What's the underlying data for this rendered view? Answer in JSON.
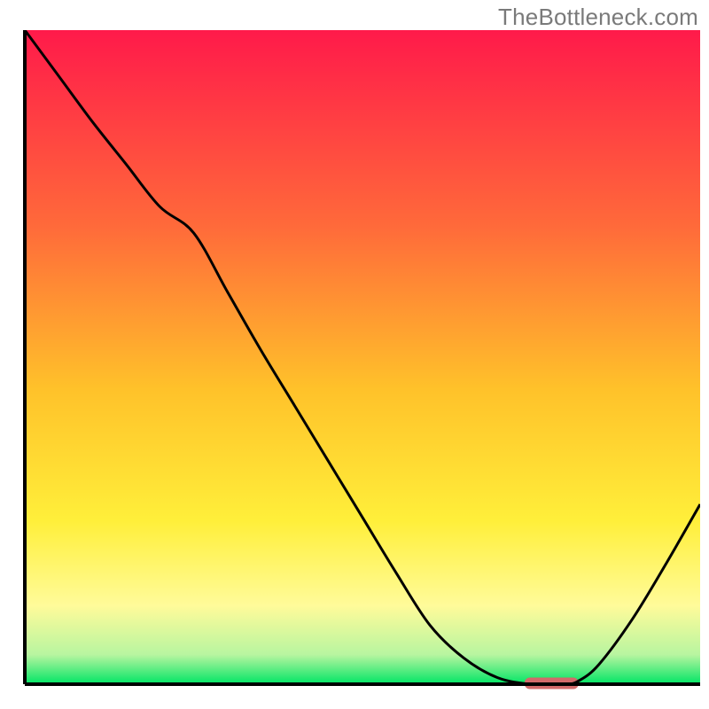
{
  "watermark": "TheBottleneck.com",
  "chart_data": {
    "type": "line",
    "title": "",
    "xlabel": "",
    "ylabel": "",
    "xlim": [
      0,
      100
    ],
    "ylim": [
      0,
      100
    ],
    "background_gradient": {
      "stops": [
        {
          "offset": 0.0,
          "color": "#ff1a4a"
        },
        {
          "offset": 0.3,
          "color": "#ff6a3a"
        },
        {
          "offset": 0.55,
          "color": "#ffc22a"
        },
        {
          "offset": 0.75,
          "color": "#ffef3a"
        },
        {
          "offset": 0.88,
          "color": "#fffb9a"
        },
        {
          "offset": 0.955,
          "color": "#b8f5a0"
        },
        {
          "offset": 1.0,
          "color": "#00e565"
        }
      ]
    },
    "x": [
      0,
      5,
      10,
      15,
      20,
      25,
      30,
      35,
      40,
      45,
      50,
      55,
      60,
      65,
      70,
      75,
      80,
      82,
      85,
      90,
      95,
      100
    ],
    "values": [
      100,
      93,
      86,
      79.5,
      73,
      69,
      60,
      51,
      42.5,
      34,
      25.5,
      17,
      9,
      4,
      1,
      0,
      0,
      0.5,
      3,
      10,
      18.5,
      27.5
    ],
    "optimum_marker": {
      "x_start": 74,
      "x_end": 82,
      "y": 0,
      "color": "#d26a6a"
    },
    "axis_color": "#000000"
  }
}
